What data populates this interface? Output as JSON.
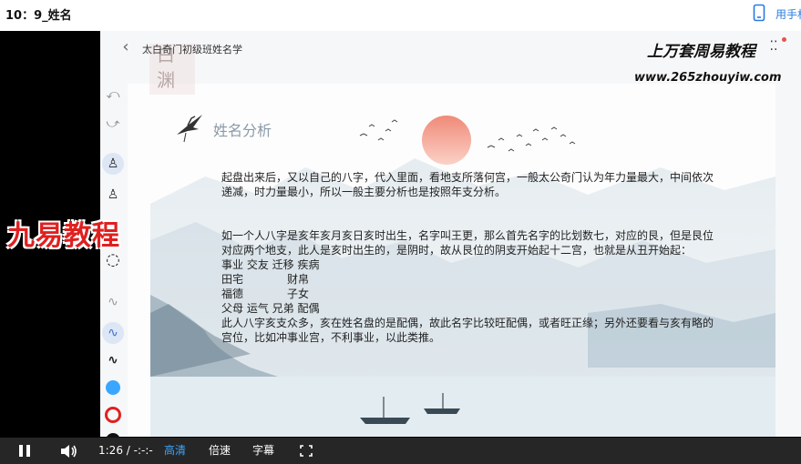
{
  "page": {
    "title": "10：9_姓名"
  },
  "topbar": {
    "phone_label": "用手机"
  },
  "slide": {
    "lesson_title": "太白奇门初级班姓名学",
    "section_title": "姓名分析",
    "watermark_cn": "上万套周易教程",
    "watermark_url": "www.265zhouyiw.com",
    "seal_char_1": "白",
    "seal_char_2": "渊",
    "paragraphs": [
      "起盘出来后，又以自己的八字，代入里面，看地支所落何宫，一般太公奇门认为年力量最大，中间依次递减，时力量最小，所以一般主要分析也是按照年支分析。",
      "如一个人八字是亥年亥月亥日亥时出生，名字叫王更，那么首先名字的比划数七，对应的艮，但是艮位对应两个地支，此人是亥时出生的，是阴时，故从艮位的阴支开始起十二宫，也就是从丑开始起：",
      "事业 交友 迁移 疾病",
      "田宅　　　　财帛",
      "福德　　　　子女",
      "父母 运气 兄弟 配偶",
      "此人八字亥支众多，亥在姓名盘的是配偶，故此名字比较旺配偶，或者旺正缘；另外还要看与亥有略的宫位，比如冲事业宫，不利事业，以此类推。"
    ]
  },
  "brand_overlay": "九易教程",
  "controls": {
    "time": "1:26 / -:-:-",
    "quality": "高清",
    "speed": "倍速",
    "subtitle": "字幕"
  },
  "colors": {
    "accent": "#3aa6ff",
    "brand_red": "#e02020",
    "sun": "#ef6a5a"
  }
}
